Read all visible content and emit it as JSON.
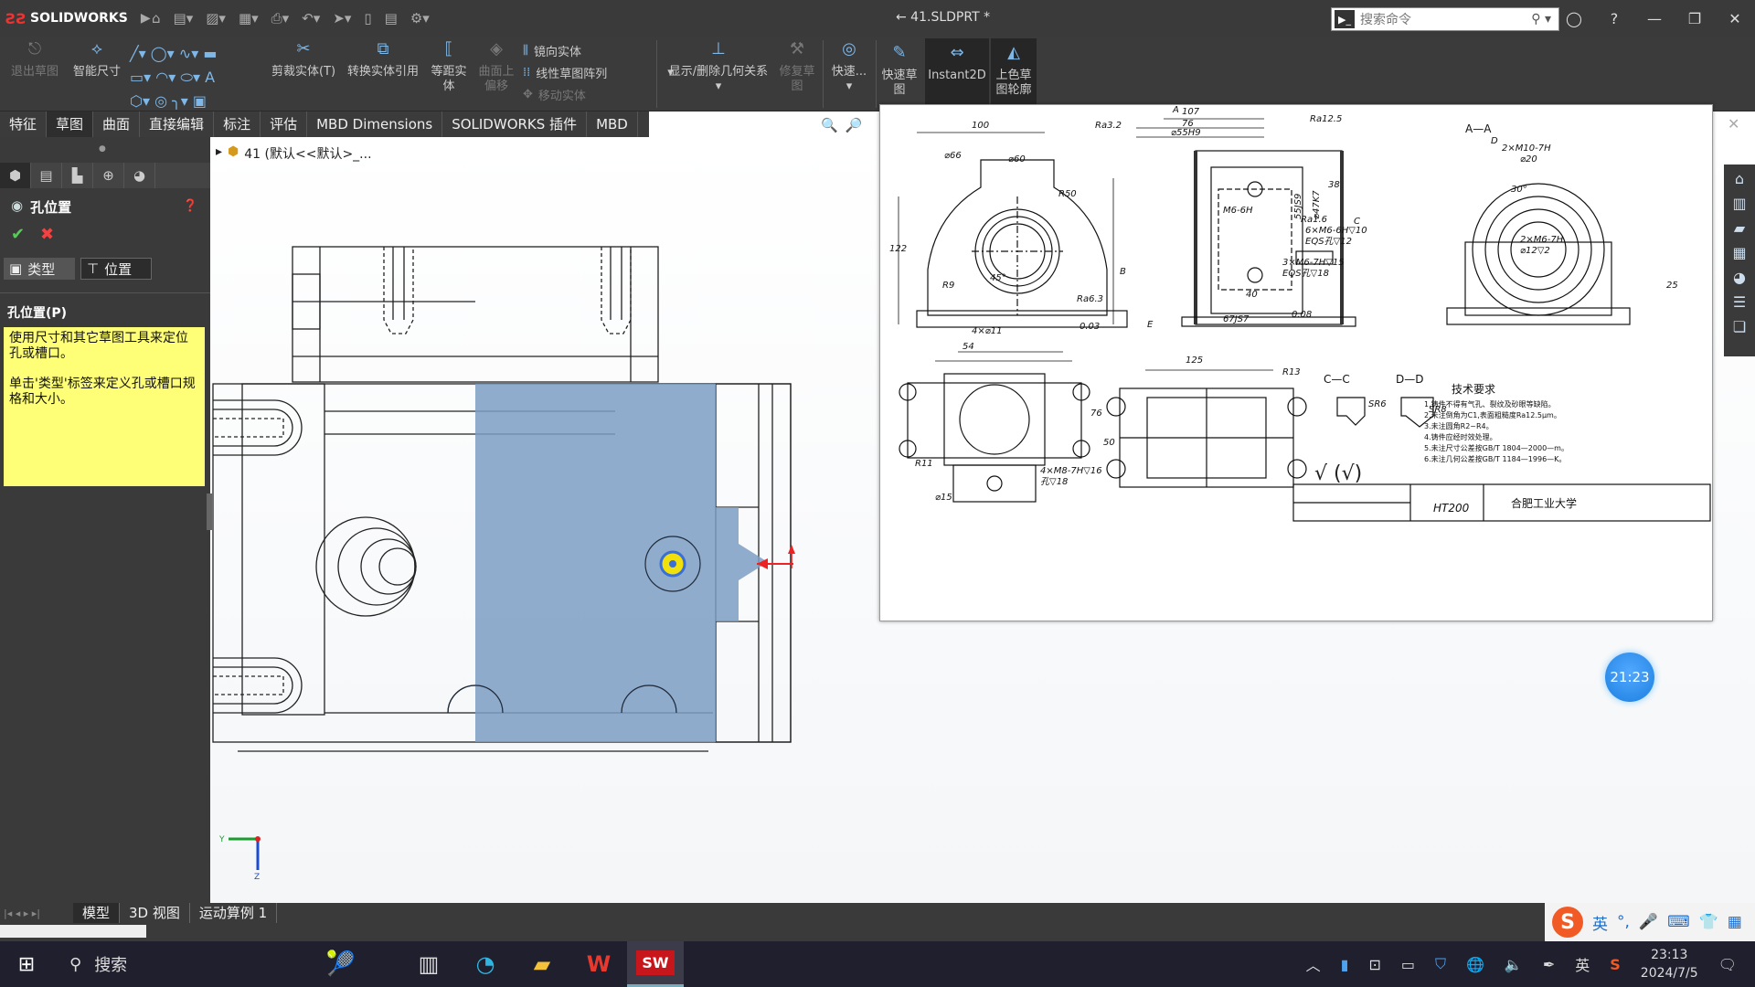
{
  "app": {
    "name": "SOLIDWORKS",
    "doc_title": "← 41.SLDPRT *"
  },
  "search": {
    "placeholder": "搜索命令"
  },
  "toolbar": {
    "exit_sketch": "退出草图",
    "smart_dim": "智能尺寸",
    "trim": "剪裁实体(T)",
    "convert": "转换实体引用",
    "offset": "等距实\n体",
    "surface_offset": "曲面上\n偏移",
    "mirror": "镜向实体",
    "linear_pattern": "线性草图阵列",
    "move": "移动实体",
    "display_relations": "显示/删除几何关系",
    "repair": "修复草\n图",
    "quick_snaps": "快速...",
    "rapid_sketch": "快速草\n图",
    "instant2d": "Instant2D",
    "shaded_sketch": "上色草\n图轮廓"
  },
  "tabs": [
    "特征",
    "草图",
    "曲面",
    "直接编辑",
    "标注",
    "评估",
    "MBD Dimensions",
    "SOLIDWORKS 插件",
    "MBD"
  ],
  "active_tab": "草图",
  "feature_tree": {
    "root": "41  (默认<<默认>_..."
  },
  "property_manager": {
    "title": "孔位置",
    "tab_type": "类型",
    "tab_position": "位置",
    "group_title": "孔位置(P)",
    "hint_1": "使用尺寸和其它草图工具来定位孔或槽口。",
    "hint_2": "单击'类型'标签来定义孔或槽口规格和大小。"
  },
  "bottom_tabs": [
    "模型",
    "3D 视图",
    "运动算例 1"
  ],
  "clock_bubble": "21:23",
  "drawing": {
    "material": "HT200",
    "school": "合肥工业大学",
    "tech_title": "技术要求",
    "tech_items": [
      "1.铸件不得有气孔、裂纹及砂眼等缺陷。",
      "2.未注倒角为C1,表面粗糙度Ra12.5μm。",
      "3.未注圆角R2~R4。",
      "4.铸件应经时效处理。",
      "5.未注尺寸公差按GB/T 1804—2000—m。",
      "6.未注几何公差按GB/T 1184—1996—K。"
    ],
    "section_aa": "A—A",
    "section_cc": "C—C",
    "section_dd": "D—D",
    "dims": [
      "100",
      "107",
      "76",
      "⌀55H9",
      "Ra3.2",
      "Ra12.5",
      "⌀66",
      "⌀60",
      "R50",
      "R9",
      "45°",
      "4×⌀11",
      "Ra6.3",
      "0.03",
      "E",
      "M6-6H",
      "⌀47K7",
      "55JS9",
      "Ra1.6",
      "6×M6-6H▽10",
      "EQS孔▽12",
      "3×M6-7H▽15",
      "EQS孔▽18",
      "0.08",
      "67JS7",
      "40",
      "2×M10-7H",
      "⌀20",
      "30°",
      "2×M6-7H",
      "⌀12▽2",
      "54",
      "125",
      "R13",
      "R11",
      "4×M8-7H▽16",
      "孔▽18",
      "⌀15",
      "SR6",
      "SR8",
      "B",
      "A",
      "C",
      "D",
      "122",
      "38",
      "25",
      "76",
      "50"
    ]
  },
  "taskbar": {
    "search_label": "搜索",
    "ime_lang": "英",
    "time": "23:13",
    "date": "2024/7/5"
  }
}
